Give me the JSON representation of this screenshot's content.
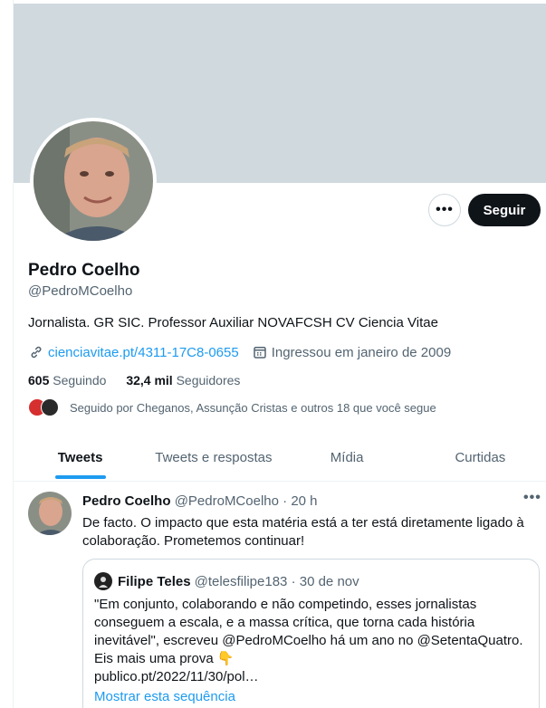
{
  "profile": {
    "name": "Pedro Coelho",
    "handle": "@PedroMCoelho",
    "bio": "Jornalista. GR SIC. Professor Auxiliar NOVAFCSH CV Ciencia Vitae",
    "website": "cienciavitae.pt/4311-17C8-0655",
    "joined": "Ingressou em janeiro de 2009",
    "following_count": "605",
    "following_label": "Seguindo",
    "followers_count": "32,4 mil",
    "followers_label": "Seguidores",
    "followed_by": "Seguido por Cheganos, Assunção Cristas e outros 18 que você segue",
    "more_icon": "ellipsis-icon",
    "follow_label": "Seguir"
  },
  "tabs": [
    {
      "label": "Tweets",
      "active": true
    },
    {
      "label": "Tweets e respostas",
      "active": false
    },
    {
      "label": "Mídia",
      "active": false
    },
    {
      "label": "Curtidas",
      "active": false
    }
  ],
  "tweet": {
    "author": "Pedro Coelho",
    "handle": "@PedroMCoelho",
    "separator": "·",
    "time": "20 h",
    "text": "De facto. O impacto que esta matéria está a ter está diretamente ligado à colaboração. Prometemos continuar!",
    "quote": {
      "author": "Filipe Teles",
      "handle": "@telesfilipe183",
      "separator": "·",
      "date": "30 de nov",
      "text": "\"Em conjunto, colaborando e não competindo, esses jornalistas conseguem a escala, e a massa crítica, que torna cada história inevitável\", escreveu  @PedroMCoelho há um ano no @SetentaQuatro. Eis mais uma prova 👇\npublico.pt/2022/11/30/pol…",
      "show_thread": "Mostrar esta sequência"
    }
  },
  "colors": {
    "accent": "#1d9bf0",
    "banner": "#cfd9de",
    "text_primary": "#0f1419",
    "text_secondary": "#536471"
  }
}
